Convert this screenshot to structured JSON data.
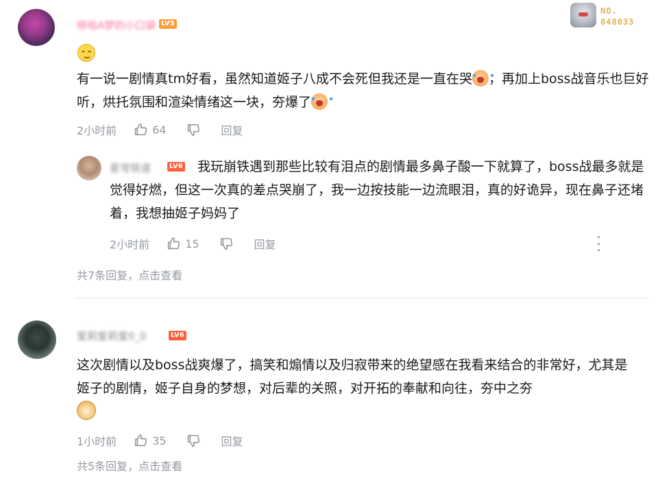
{
  "header_badge": {
    "label": "NO.",
    "number": "048033"
  },
  "comments": [
    {
      "username": "哆啦A梦的小口袋",
      "level": "LV5",
      "text": "有一说一剧情真tm好看，虽然知道姬子八成不会死但我还是一直在哭",
      "text_mid": "，再加上boss战音乐也巨好听，烘托氛围和渲染情绪这一块，夯爆了",
      "time": "2小时前",
      "likes": "64",
      "reply_label": "回复",
      "replies": [
        {
          "username": "星穹铁道",
          "level": "LV6",
          "text": "我玩崩铁遇到那些比较有泪点的剧情最多鼻子酸一下就算了，boss战最多就是觉得好燃，但这一次真的差点哭崩了，我一边按技能一边流眼泪，真的好诡异，现在鼻子还堵着，我想抽姬子妈妈了",
          "time": "2小时前",
          "likes": "15",
          "reply_label": "回复"
        }
      ],
      "view_more": "共7条回复，点击查看"
    },
    {
      "username": "爱莉爱莉爱0_0",
      "level": "LV6",
      "text": "这次剧情以及boss战爽爆了，搞笑和煽情以及归寂带来的绝望感在我看来结合的非常好，尤其是姬子的剧情，姬子自身的梦想，对后辈的关照，对开拓的奉献和向往，夯中之夯",
      "time": "1小时前",
      "likes": "35",
      "reply_label": "回复",
      "view_more": "共5条回复，点击查看"
    }
  ],
  "colors": {
    "username": "#fb7299",
    "meta": "#9499a0",
    "text": "#18191c",
    "lv5": "#ff9c3a",
    "lv6": "#ff5f3a"
  }
}
